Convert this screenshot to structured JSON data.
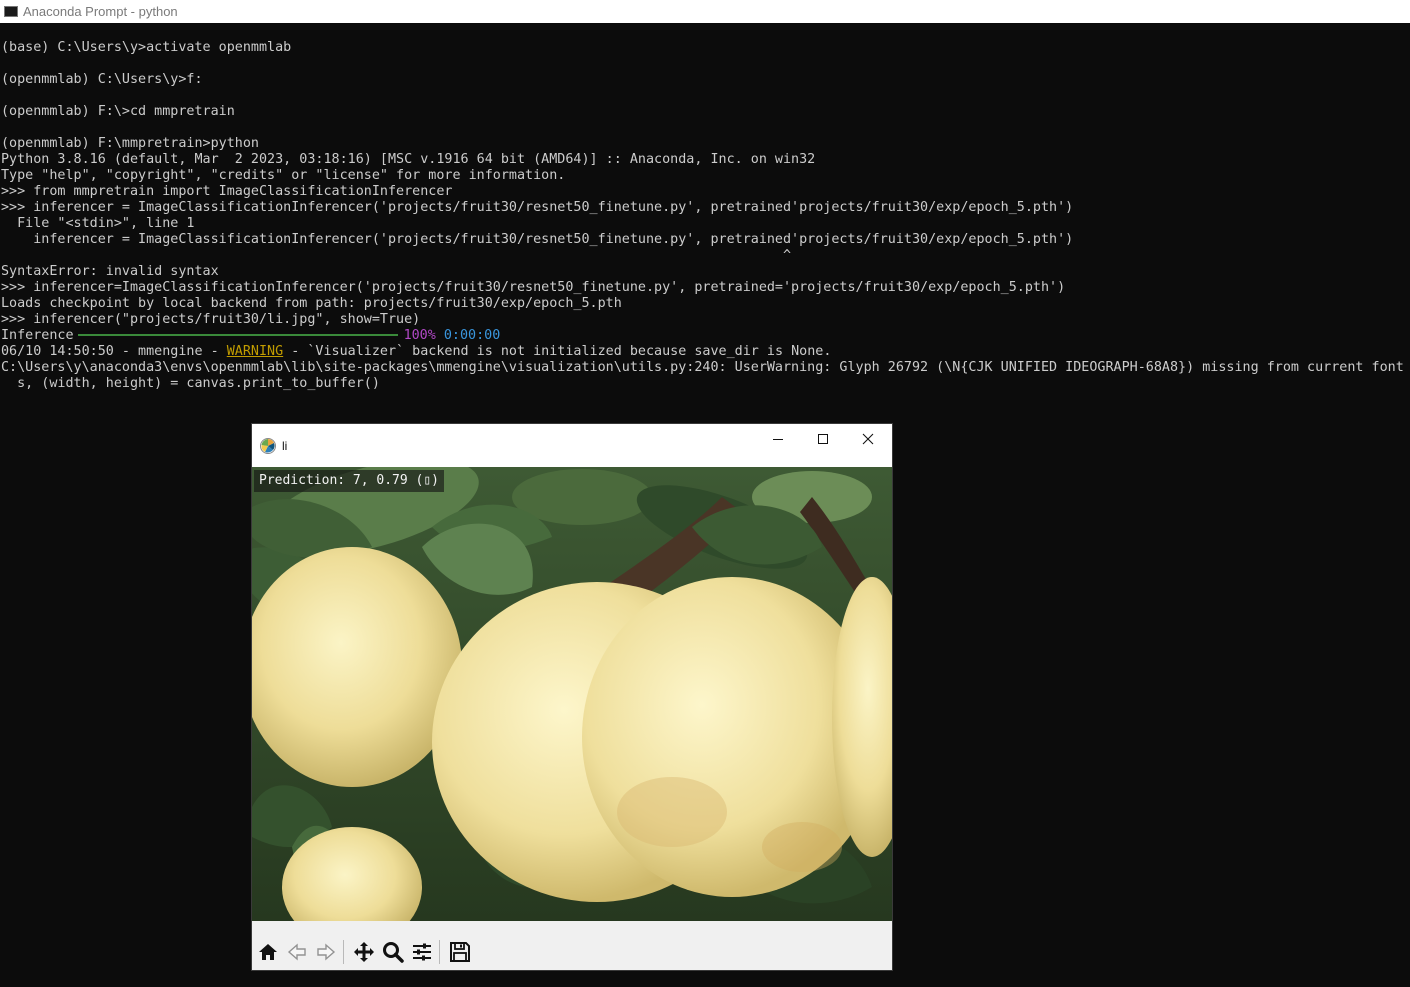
{
  "console_window": {
    "title": "Anaconda Prompt - python"
  },
  "console": {
    "lines": [
      "(base) C:\\Users\\y>activate openmmlab",
      "",
      "(openmmlab) C:\\Users\\y>f:",
      "",
      "(openmmlab) F:\\>cd mmpretrain",
      "",
      "(openmmlab) F:\\mmpretrain>python",
      "Python 3.8.16 (default, Mar  2 2023, 03:18:16) [MSC v.1916 64 bit (AMD64)] :: Anaconda, Inc. on win32",
      "Type \"help\", \"copyright\", \"credits\" or \"license\" for more information.",
      ">>> from mmpretrain import ImageClassificationInferencer",
      ">>> inferencer = ImageClassificationInferencer('projects/fruit30/resnet50_finetune.py', pretrained'projects/fruit30/exp/epoch_5.pth')",
      "  File \"<stdin>\", line 1",
      "    inferencer = ImageClassificationInferencer('projects/fruit30/resnet50_finetune.py', pretrained'projects/fruit30/exp/epoch_5.pth')",
      "                                                                                                 ^",
      "SyntaxError: invalid syntax",
      ">>> inferencer=ImageClassificationInferencer('projects/fruit30/resnet50_finetune.py', pretrained='projects/fruit30/exp/epoch_5.pth')",
      "Loads checkpoint by local backend from path: projects/fruit30/exp/epoch_5.pth",
      ">>> inferencer(\"projects/fruit30/li.jpg\", show=True)"
    ],
    "progress": {
      "label": "Inference",
      "fraction": 1.0,
      "percent": "100%",
      "time": "0:00:00"
    },
    "warning_line": {
      "prefix": "06/10 14:50:50 - mmengine - ",
      "level": "WARNING",
      "suffix": " - `Visualizer` backend is not initialized because save_dir is None."
    },
    "tail_lines": [
      "C:\\Users\\y\\anaconda3\\envs\\openmmlab\\lib\\site-packages\\mmengine\\visualization\\utils.py:240: UserWarning: Glyph 26792 (\\N{CJK UNIFIED IDEOGRAPH-68A8}) missing from current font.",
      "  s, (width, height) = canvas.print_to_buffer()"
    ]
  },
  "figure_window": {
    "title": "li",
    "prediction_text": "Prediction: 7, 0.79 (▯)",
    "image_description_icon": "pear-photo",
    "toolbar": [
      {
        "name": "home-icon"
      },
      {
        "name": "back-arrow-icon"
      },
      {
        "name": "forward-arrow-icon"
      },
      {
        "name": "pan-icon"
      },
      {
        "name": "zoom-icon"
      },
      {
        "name": "configure-subplots-icon"
      },
      {
        "name": "save-icon"
      }
    ]
  },
  "colors": {
    "console_bg": "#0c0c0c",
    "console_text": "#cccccc",
    "warning": "#c19c00",
    "percent": "#b148c6",
    "time": "#3a96dd",
    "progress_bar": "#3a8a3a"
  }
}
